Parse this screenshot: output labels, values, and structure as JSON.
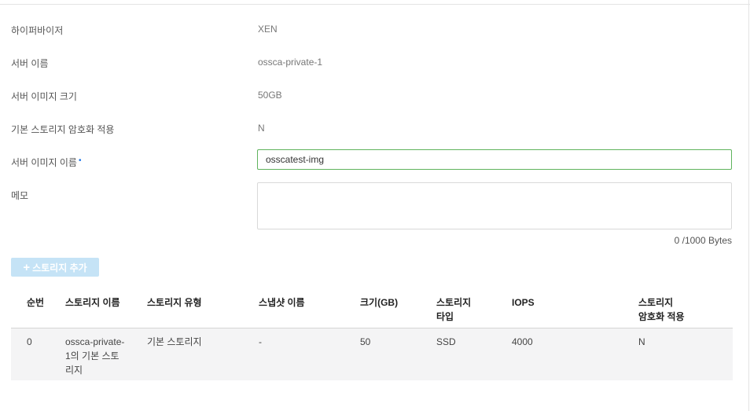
{
  "form": {
    "hypervisor": {
      "label": "하이퍼바이저",
      "value": "XEN"
    },
    "server_name": {
      "label": "서버 이름",
      "value": "ossca-private-1"
    },
    "image_size": {
      "label": "서버 이미지 크기",
      "value": "50GB"
    },
    "encryption": {
      "label": "기본 스토리지 암호화 적용",
      "value": "N"
    },
    "image_name": {
      "label": "서버 이미지 이름",
      "required_mark": "•",
      "value": "osscatest-img"
    },
    "memo": {
      "label": "메모",
      "value": "",
      "counter": "0 /1000 Bytes"
    }
  },
  "add_storage_button": {
    "label": "스토리지 추가",
    "icon": "plus-icon"
  },
  "table": {
    "headers": [
      "순번",
      "스토리지 이름",
      "스토리지 유형",
      "스냅샷 이름",
      "크기(GB)",
      "스토리지\n타입",
      "IOPS",
      "스토리지\n암호화 적용"
    ],
    "rows": [
      [
        "0",
        "ossca-private-1의 기본 스토리지",
        "기본 스토리지",
        "-",
        "50",
        "SSD",
        "4000",
        "N"
      ]
    ]
  },
  "colors": {
    "accent_green": "#5fb35d",
    "button_disabled": "#c5e3f6",
    "required_dot": "#1a73e8"
  }
}
